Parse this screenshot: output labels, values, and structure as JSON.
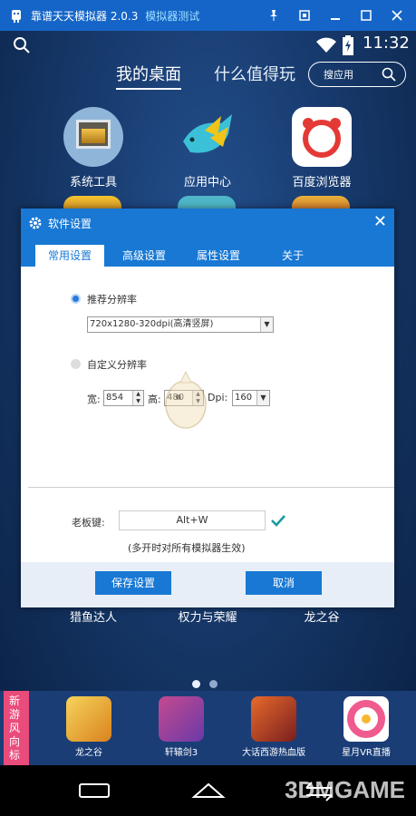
{
  "window": {
    "title": "靠谱天天模拟器 2.0.3",
    "mode": "模拟器测试"
  },
  "statusbar": {
    "time": "11:32"
  },
  "home": {
    "tabs": [
      "我的桌面",
      "什么值得玩"
    ],
    "search_placeholder": "搜应用",
    "apps": [
      {
        "label": "系统工具",
        "icon": "system-tools-icon"
      },
      {
        "label": "应用中心",
        "icon": "app-center-icon"
      },
      {
        "label": "百度浏览器",
        "icon": "baidu-browser-icon"
      }
    ],
    "row2_labels": [
      "猎鱼达人",
      "权力与荣耀",
      "龙之谷"
    ]
  },
  "dialog": {
    "title": "软件设置",
    "tabs": [
      "常用设置",
      "高级设置",
      "属性设置",
      "关于"
    ],
    "active_tab": "常用设置",
    "recommended_label": "推荐分辨率",
    "recommended_value": "720x1280-320dpi(高清竖屏)",
    "custom_label": "自定义分辨率",
    "width_label": "宽:",
    "width_value": "854",
    "height_label": "高:",
    "height_value": "480",
    "dpi_label": "Dpi:",
    "dpi_value": "160",
    "hotkey_label": "老板键:",
    "hotkey_value": "Alt+W",
    "hotkey_note": "(多开时对所有模拟器生效)",
    "save_button": "保存设置",
    "cancel_button": "取消"
  },
  "strip": {
    "badge": "新游风向标",
    "games": [
      "龙之谷",
      "轩辕剑3",
      "大话西游热血版",
      "星月VR直播"
    ]
  },
  "watermark": "3DMGAME",
  "colors": {
    "accent": "#1878d4",
    "titlebar": "#1565c8",
    "badge": "#e94b7a"
  }
}
